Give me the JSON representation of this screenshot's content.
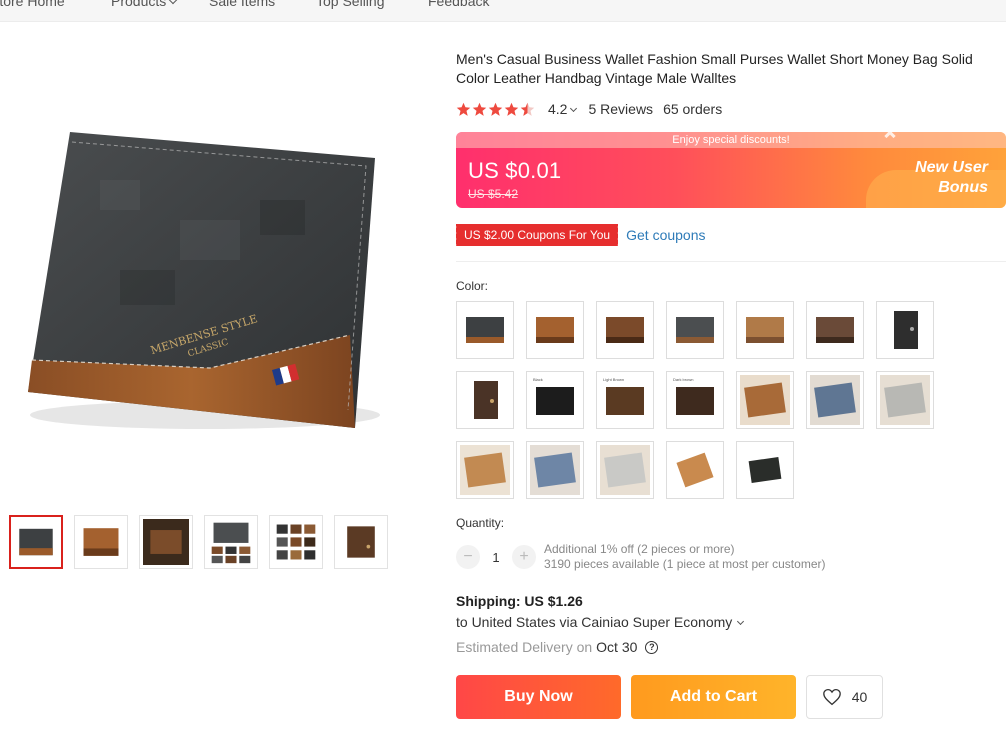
{
  "nav": {
    "items": [
      {
        "label": "Store Home"
      },
      {
        "label": "Products"
      },
      {
        "label": "Sale Items"
      },
      {
        "label": "Top Selling"
      },
      {
        "label": "Feedback"
      }
    ]
  },
  "product": {
    "title": "Men's Casual Business Wallet Fashion Small Purses Wallet Short Money Bag Solid Color Leather Handbag Vintage Male Walltes",
    "image_brand_text": "MENBENSE STYLE",
    "image_brand_sub": "CLASSIC"
  },
  "rating": {
    "value": "4.2",
    "stars": 4.2,
    "reviews": "5 Reviews",
    "orders": "65 orders"
  },
  "price": {
    "banner_text": "Enjoy special discounts!",
    "current": "US $0.01",
    "original": "US $5.42",
    "bonus_line1": "New User",
    "bonus_line2": "Bonus"
  },
  "coupon": {
    "badge": "US $2.00 Coupons For You",
    "link": "Get coupons"
  },
  "color": {
    "label": "Color:",
    "swatch_labels": [
      "Black",
      "Light Brown",
      "Dark brown"
    ]
  },
  "quantity": {
    "label": "Quantity:",
    "value": "1",
    "minus": "−",
    "plus": "+",
    "discount_info": "Additional 1% off (2 pieces or more)",
    "stock_info": "3190 pieces available (1 piece at most per customer)"
  },
  "shipping": {
    "cost": "Shipping: US $1.26",
    "route": "to United States via Cainiao Super Economy",
    "delivery_label": "Estimated Delivery on",
    "delivery_date": "Oct 30"
  },
  "actions": {
    "buy_now": "Buy Now",
    "add_to_cart": "Add to Cart",
    "wishlist_count": "40"
  },
  "colors": {
    "star": "#ee4a3f",
    "buy_now": "#ff4747",
    "add_to_cart": "#ffa31c",
    "coupon_badge": "#e62e2e",
    "link": "#2e7bb8"
  }
}
